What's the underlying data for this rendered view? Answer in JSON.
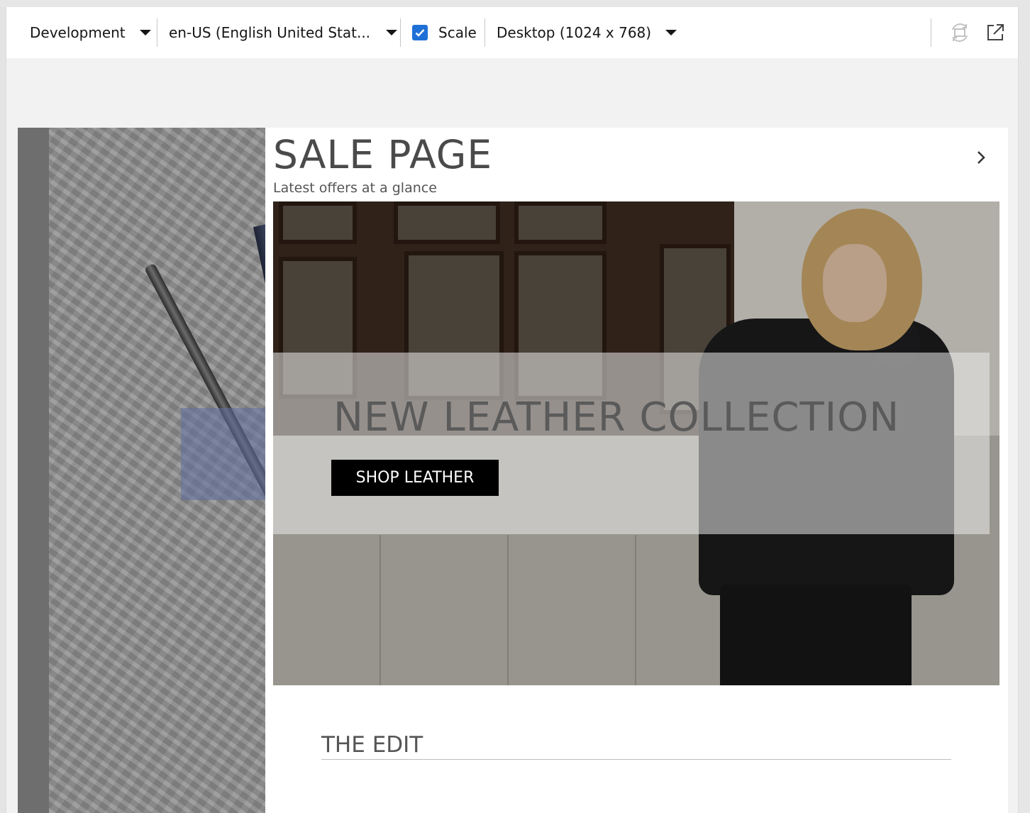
{
  "toolbar": {
    "environment": "Development",
    "locale": "en-US (English United Stat...",
    "scale_label": "Scale",
    "scale_checked": true,
    "device": "Desktop (1024 x 768)",
    "icons": [
      "rotate-device-icon",
      "open-external-icon"
    ],
    "checkbox_color": "#1f70d6"
  },
  "page": {
    "title": "SALE PAGE",
    "subtitle": "Latest offers at a glance"
  },
  "hero": {
    "heading": "NEW LEATHER COLLECTION",
    "button": "SHOP LEATHER"
  },
  "section": {
    "title": "THE EDIT"
  }
}
